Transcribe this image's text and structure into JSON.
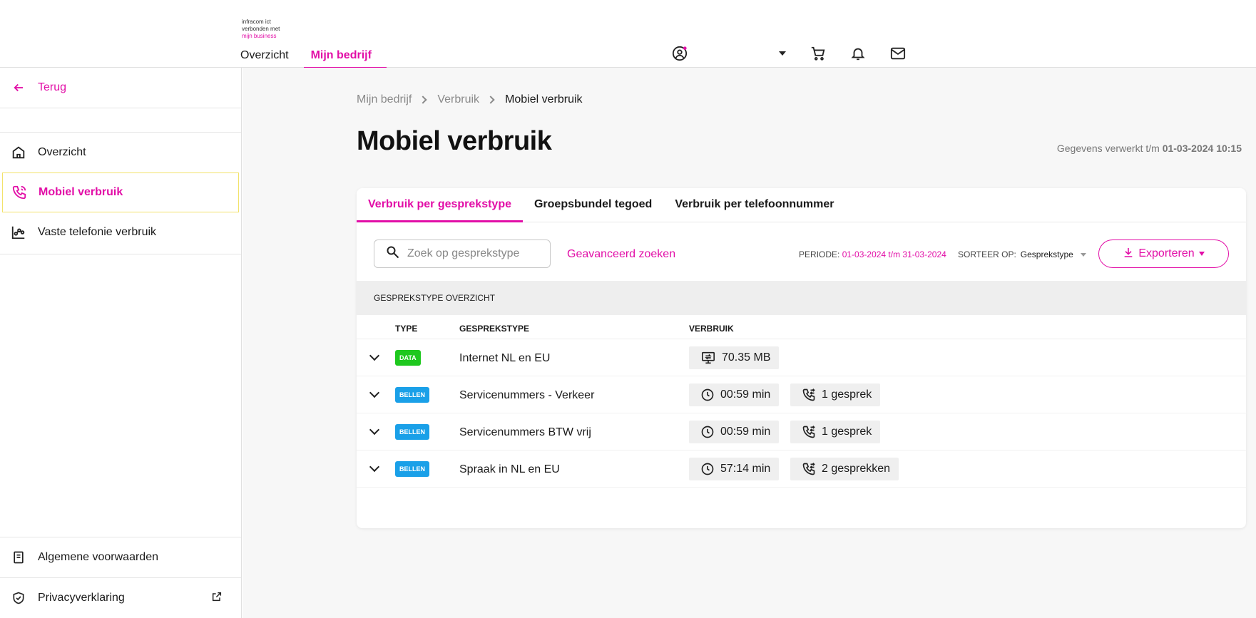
{
  "header": {
    "logo_lines": [
      "infracom ict",
      "verbonden met",
      "mijn business"
    ],
    "nav": [
      {
        "label": "Overzicht",
        "active": false
      },
      {
        "label": "Mijn bedrijf",
        "active": true
      }
    ],
    "icons": [
      "user-icon",
      "chevron-down-icon",
      "cart-icon",
      "bell-icon",
      "mail-icon"
    ]
  },
  "sidebar": {
    "back_label": "Terug",
    "items": [
      {
        "label": "Overzicht",
        "icon": "home-icon",
        "active": false
      },
      {
        "label": "Mobiel verbruik",
        "icon": "phone-icon",
        "active": true
      },
      {
        "label": "Vaste telefonie verbruik",
        "icon": "chart-icon",
        "active": false
      }
    ],
    "bottom": [
      {
        "label": "Algemene voorwaarden",
        "icon": "book-icon"
      },
      {
        "label": "Privacyverklaring",
        "icon": "shield-icon"
      }
    ]
  },
  "breadcrumb": [
    "Mijn bedrijf",
    "Verbruik",
    "Mobiel verbruik"
  ],
  "page": {
    "title": "Mobiel verbruik",
    "processed_prefix": "Gegevens verwerkt t/m",
    "processed_date": "01-03-2024 10:15"
  },
  "tabs": [
    {
      "label": "Verbruik per gesprekstype",
      "active": true
    },
    {
      "label": "Groepsbundel tegoed",
      "active": false
    },
    {
      "label": "Verbruik per telefoonnummer",
      "active": false
    }
  ],
  "toolbar": {
    "search_placeholder": "Zoek op gesprekstype",
    "advanced_label": "Geavanceerd zoeken",
    "periode_label": "PERIODE:",
    "periode_value": "01-03-2024 t/m 31-03-2024",
    "sort_label": "SORTEER OP:",
    "sort_value": "Gesprekstype",
    "export_label": "Exporteren"
  },
  "table": {
    "section_title": "GESPREKSTYPE OVERZICHT",
    "columns": [
      "TYPE",
      "GESPREKSTYPE",
      "VERBRUIK"
    ],
    "rows": [
      {
        "badge": "DATA",
        "name": "Internet NL en EU",
        "usage": "70.35 MB",
        "calls": ""
      },
      {
        "badge": "BELLEN",
        "name": "Servicenummers - Verkeer",
        "usage": "00:59 min",
        "calls": "1 gesprek"
      },
      {
        "badge": "BELLEN",
        "name": "Servicenummers BTW vrij",
        "usage": "00:59 min",
        "calls": "1 gesprek"
      },
      {
        "badge": "BELLEN",
        "name": "Spraak in NL en EU",
        "usage": "57:14 min",
        "calls": "2 gesprekken"
      }
    ]
  },
  "colors": {
    "accent": "#e20ea7",
    "data_badge": "#1ec81e",
    "bellen_badge": "#1aa0e8"
  }
}
